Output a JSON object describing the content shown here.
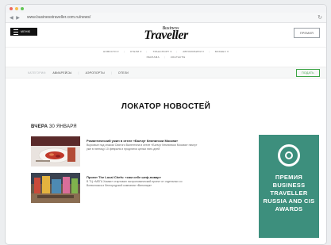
{
  "browser": {
    "url": "www.businesstraveller.com.ru/news/",
    "back_forward": "◀ ▶",
    "reload": "↻"
  },
  "header": {
    "menu_label": "МЕНЮ",
    "logo_top": "Business",
    "logo_main": "Traveller",
    "premia_label": "ПРЕМИЯ"
  },
  "subnav": {
    "row1": [
      "НОВОСТИ ▾",
      "ОТЕЛИ ▾",
      "ТРАНСПОРТ ▾",
      "АВТОМОБИЛИ ▾",
      "БИЗНЕС ▾"
    ],
    "row2": [
      "РЕКЛАМА",
      "КОНТАКТЫ"
    ]
  },
  "catbar": {
    "label": "КАТЕГОРИИ:",
    "items": [
      "АВИАРЕЙСЫ",
      "АЭРОПОРТЫ",
      "ОТЕЛИ"
    ],
    "submit_label": "ПОДАТЬ"
  },
  "page": {
    "title": "ЛОКАТОР НОВОСТЕЙ"
  },
  "section": {
    "day": "ВЧЕРА",
    "date": "30 ЯНВАРЯ"
  },
  "news": [
    {
      "title": "Романтический ужин в отеле «Балчуг Кемпински Москва»",
      "text": "Вкусовые под знаком Святого Валентина в отеле «Балчуг Кемпински Москва» начнут уже в пятницу 10 февраля и продлятся целых пять дней"
    },
    {
      "title": "Проект The Local Chefs: «сам себе шеф-повар»",
      "text": "В ТЦ «МЕГА Химки» стартовал гастрономический проект от отдельных со Всеволожск и белгородской компании «Винопарк»"
    }
  ],
  "banner": {
    "lines": [
      "ПРЕМИЯ",
      "BUSINESS",
      "TRAVELLER",
      "RUSSIA AND CIS",
      "AWARDS"
    ]
  },
  "colors": {
    "accent_green": "#3da546",
    "banner_teal": "#3d8f7d",
    "menu_dark": "#121212"
  }
}
